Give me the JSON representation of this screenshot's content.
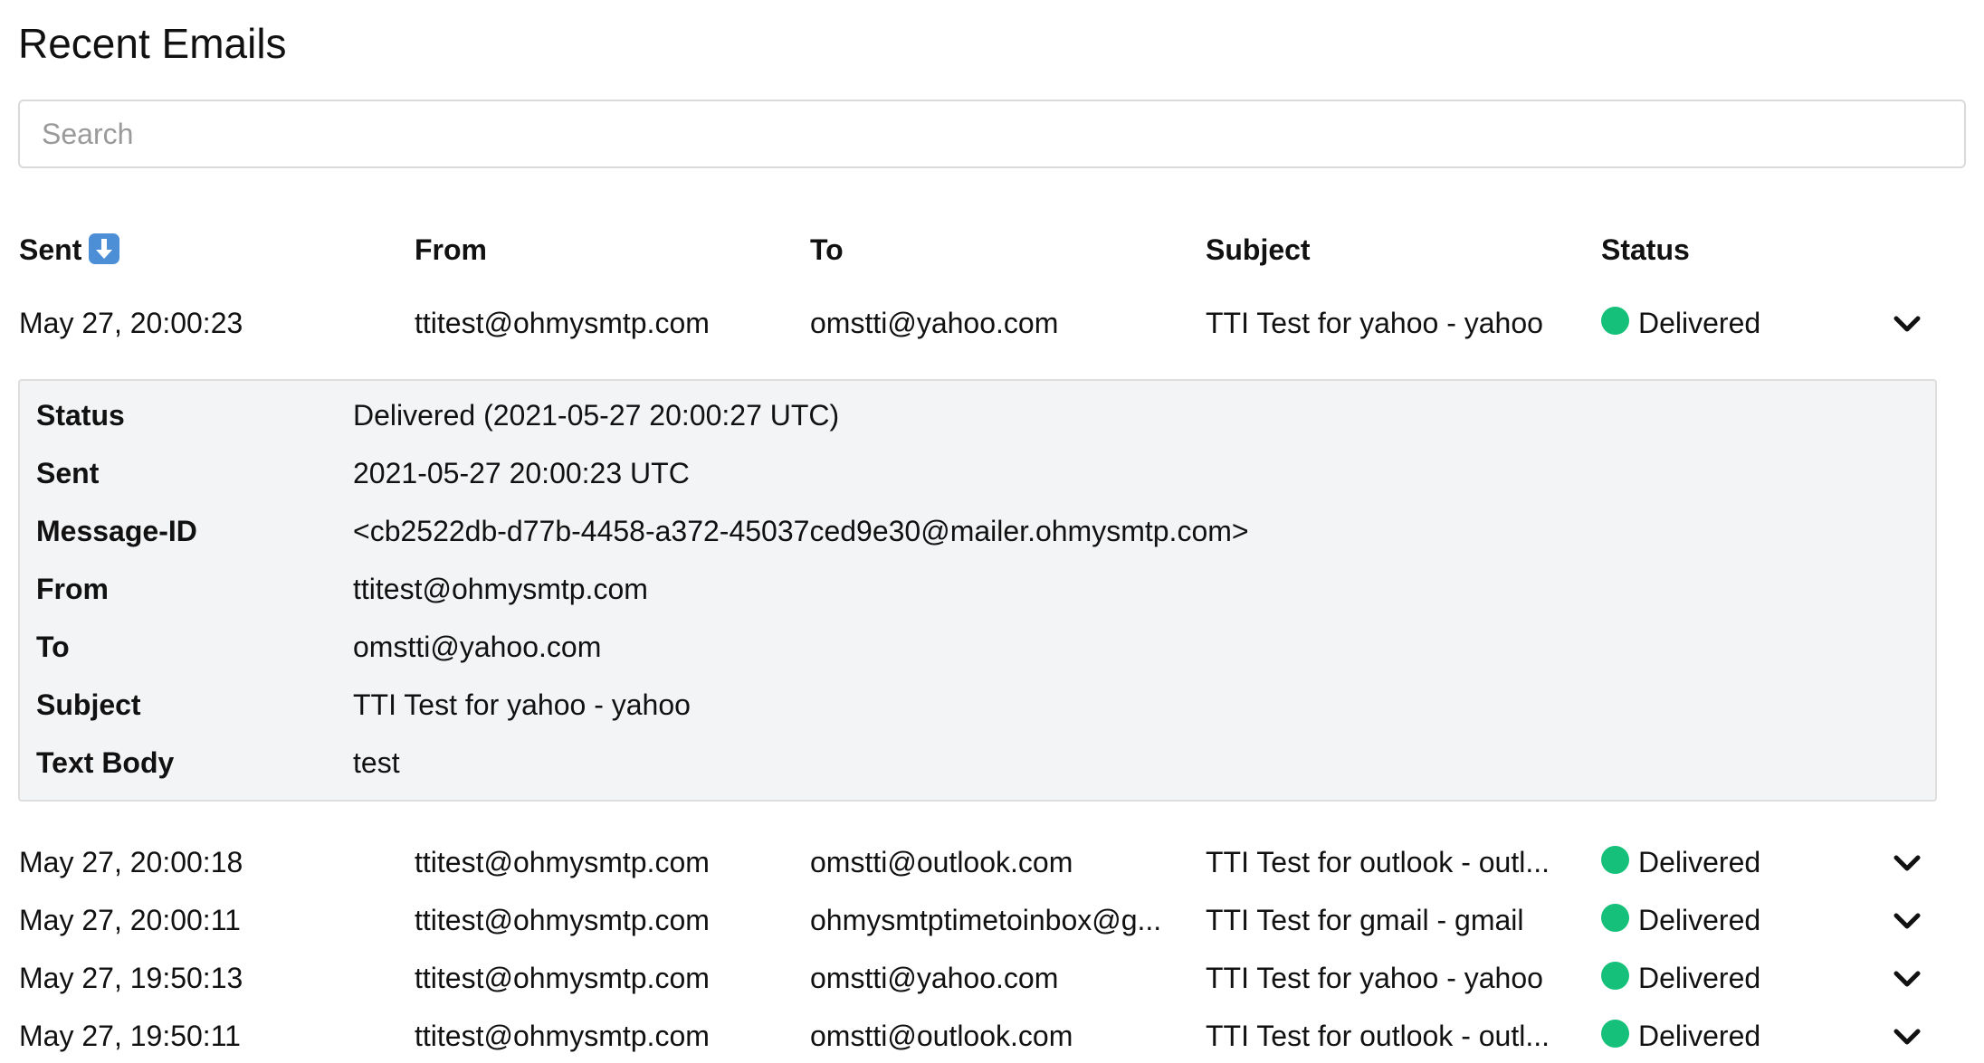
{
  "page_title": "Recent Emails",
  "search": {
    "placeholder": "Search",
    "value": ""
  },
  "columns": {
    "sent": "Sent",
    "from": "From",
    "to": "To",
    "subject": "Subject",
    "status": "Status"
  },
  "sort_icon": "down-arrow-icon",
  "status_color": "#14c07a",
  "emails": [
    {
      "sent": "May 27, 20:00:23",
      "from": "ttitest@ohmysmtp.com",
      "to": "omstti@yahoo.com",
      "subject": "TTI Test for yahoo - yahoo",
      "status": "Delivered"
    },
    {
      "sent": "May 27, 20:00:18",
      "from": "ttitest@ohmysmtp.com",
      "to": "omstti@outlook.com",
      "subject": "TTI Test for outlook - outl...",
      "status": "Delivered"
    },
    {
      "sent": "May 27, 20:00:11",
      "from": "ttitest@ohmysmtp.com",
      "to": "ohmysmtptimetoinbox@g...",
      "subject": "TTI Test for gmail - gmail",
      "status": "Delivered"
    },
    {
      "sent": "May 27, 19:50:13",
      "from": "ttitest@ohmysmtp.com",
      "to": "omstti@yahoo.com",
      "subject": "TTI Test for yahoo - yahoo",
      "status": "Delivered"
    },
    {
      "sent": "May 27, 19:50:11",
      "from": "ttitest@ohmysmtp.com",
      "to": "omstti@outlook.com",
      "subject": "TTI Test for outlook - outl...",
      "status": "Delivered"
    }
  ],
  "details": {
    "status": {
      "label": "Status",
      "value": "Delivered (2021-05-27 20:00:27 UTC)"
    },
    "sent": {
      "label": "Sent",
      "value": "2021-05-27 20:00:23 UTC"
    },
    "message_id": {
      "label": "Message-ID",
      "value": "<cb2522db-d77b-4458-a372-45037ced9e30@mailer.ohmysmtp.com>"
    },
    "from": {
      "label": "From",
      "value": "ttitest@ohmysmtp.com"
    },
    "to": {
      "label": "To",
      "value": "omstti@yahoo.com"
    },
    "subject": {
      "label": "Subject",
      "value": "TTI Test for yahoo - yahoo"
    },
    "text_body": {
      "label": "Text Body",
      "value": "test"
    }
  }
}
